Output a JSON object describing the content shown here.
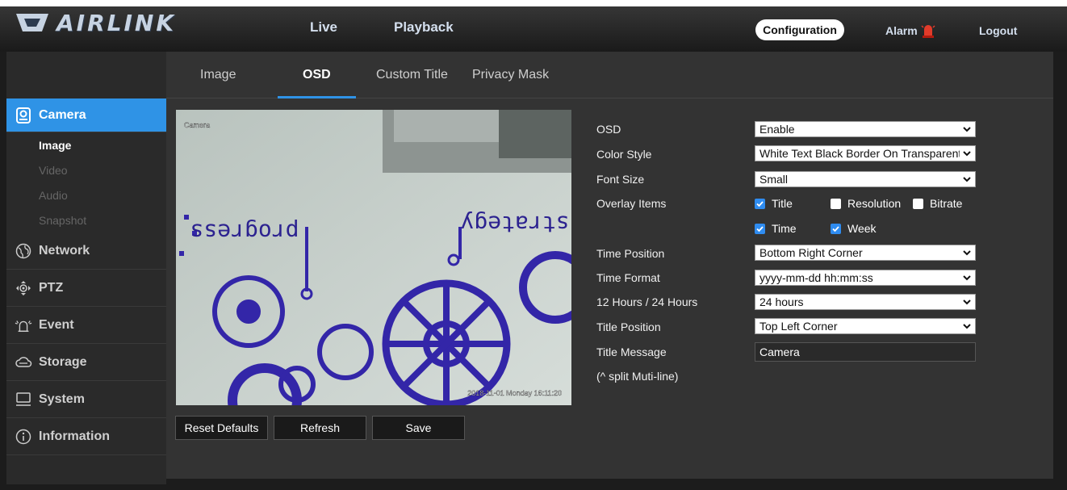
{
  "brand": {
    "name": "AIRLINK"
  },
  "topnav": {
    "live": "Live",
    "playback": "Playback",
    "configuration": "Configuration",
    "alarm": "Alarm",
    "logout": "Logout"
  },
  "sidebar": {
    "categories": [
      {
        "label": "Camera",
        "icon": "camera-icon"
      },
      {
        "label": "Network",
        "icon": "globe-icon"
      },
      {
        "label": "PTZ",
        "icon": "ptz-icon"
      },
      {
        "label": "Event",
        "icon": "event-icon"
      },
      {
        "label": "Storage",
        "icon": "cloud-icon"
      },
      {
        "label": "System",
        "icon": "monitor-icon"
      },
      {
        "label": "Information",
        "icon": "info-icon"
      }
    ],
    "camera_sub": [
      "Image",
      "Video",
      "Audio",
      "Snapshot"
    ]
  },
  "tabs": [
    "Image",
    "OSD",
    "Custom Title",
    "Privacy Mask"
  ],
  "preview": {
    "title_overlay": "Camera",
    "time_overlay": "2018-11-01 Monday 16:11:20",
    "wall_text_1": "progress",
    "wall_text_2": "strategy"
  },
  "buttons": {
    "reset": "Reset Defaults",
    "refresh": "Refresh",
    "save": "Save"
  },
  "form": {
    "osd_label": "OSD",
    "osd_value": "Enable",
    "color_label": "Color Style",
    "color_value": "White Text Black Border On Transparent",
    "font_label": "Font Size",
    "font_value": "Small",
    "overlay_label": "Overlay Items",
    "overlay_items": [
      {
        "label": "Title",
        "checked": true
      },
      {
        "label": "Resolution",
        "checked": false
      },
      {
        "label": "Bitrate",
        "checked": false
      },
      {
        "label": "Time",
        "checked": true
      },
      {
        "label": "Week",
        "checked": true
      }
    ],
    "time_pos_label": "Time Position",
    "time_pos_value": "Bottom Right Corner",
    "time_fmt_label": "Time Format",
    "time_fmt_value": "yyyy-mm-dd hh:mm:ss",
    "hours_label": "12 Hours / 24 Hours",
    "hours_value": "24 hours",
    "title_pos_label": "Title Position",
    "title_pos_value": "Top Left Corner",
    "title_msg_label": "Title Message",
    "title_msg_value": "Camera",
    "split_hint": "(^ split Muti-line)"
  },
  "colors": {
    "accent": "#2f93e6",
    "topbar": "#2a2a2a",
    "panel": "#333333"
  }
}
